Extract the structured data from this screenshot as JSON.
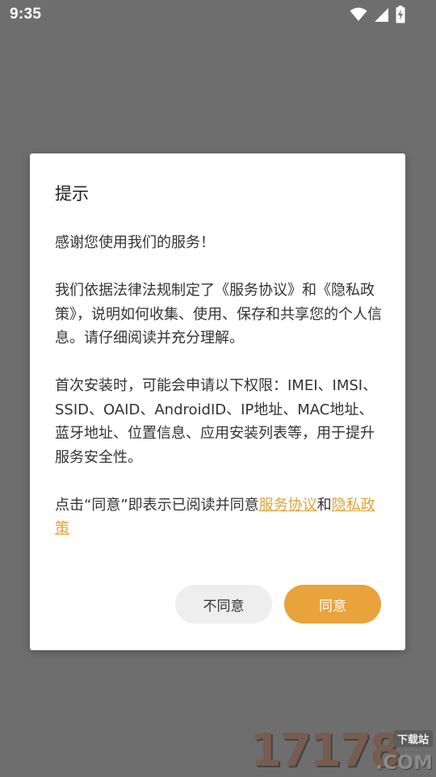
{
  "status_bar": {
    "time": "9:35",
    "icons": [
      "wifi-icon",
      "signal-icon",
      "battery-charging-icon"
    ]
  },
  "dialog": {
    "title": "提示",
    "paragraphs": {
      "thanks": "感谢您使用我们的服务！",
      "policy": "我们依据法律法规制定了《服务协议》和《隐私政策》，说明如何收集、使用、保存和共享您的个人信息。请仔细阅读并充分理解。",
      "permissions": "首次安装时，可能会申请以下权限：IMEI、IMSI、SSID、OAID、AndroidID、IP地址、MAC地址、蓝牙地址、位置信息、应用安装列表等，用于提升服务安全性。",
      "consent_prefix": "点击“同意”即表示已阅读并同意",
      "consent_link_service": "服务协议",
      "consent_and": "和",
      "consent_link_privacy": "隐私政策"
    },
    "buttons": {
      "disagree": "不同意",
      "agree": "同意"
    }
  },
  "watermark": {
    "digits": "17178",
    "badge": "下载站",
    "suffix": ".COM"
  },
  "colors": {
    "overlay_bg": "#6e6e6e",
    "accent": "#e8a33c",
    "link": "#e0a33a",
    "secondary_button_bg": "#eeeeee"
  }
}
